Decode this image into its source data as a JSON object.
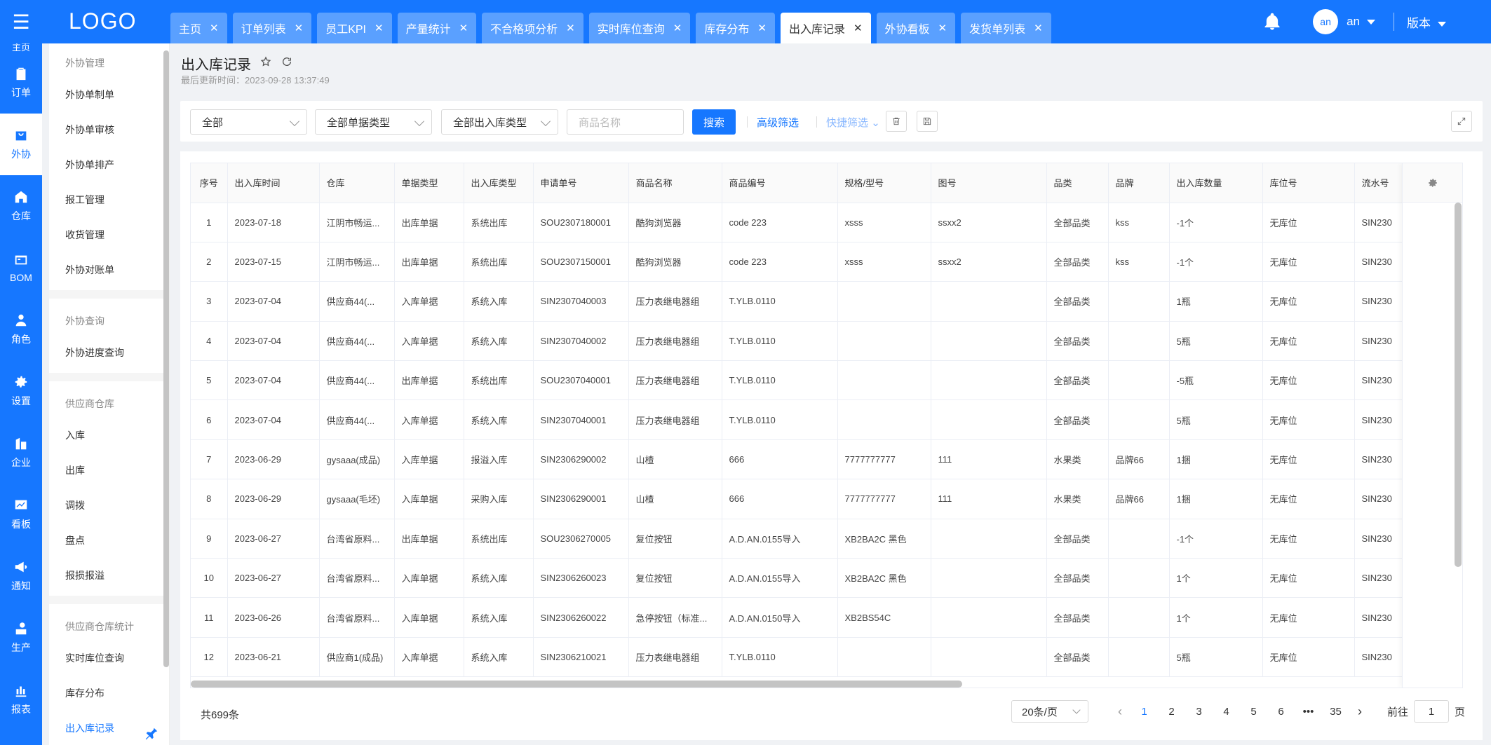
{
  "rail": [
    {
      "label": "主页",
      "icon": "home-icon"
    },
    {
      "label": "订单",
      "icon": "clipboard-icon"
    },
    {
      "label": "外协",
      "icon": "bag-icon"
    },
    {
      "label": "仓库",
      "icon": "warehouse-icon"
    },
    {
      "label": "BOM",
      "icon": "box-icon"
    },
    {
      "label": "角色",
      "icon": "user-icon"
    },
    {
      "label": "设置",
      "icon": "gear-icon"
    },
    {
      "label": "企业",
      "icon": "building-icon"
    },
    {
      "label": "看板",
      "icon": "chart-icon"
    },
    {
      "label": "通知",
      "icon": "megaphone-icon"
    },
    {
      "label": "生产",
      "icon": "factory-icon"
    },
    {
      "label": "报表",
      "icon": "report-icon"
    }
  ],
  "header": {
    "logo": "LOGO",
    "tabs": [
      "主页",
      "订单列表",
      "员工KPI",
      "产量统计",
      "不合格项分析",
      "实时库位查询",
      "库存分布",
      "出入库记录",
      "外协看板",
      "发货单列表"
    ],
    "active_tab": "出入库记录",
    "avatar": "an",
    "user": "an",
    "version": "版本"
  },
  "submenu": {
    "groups": [
      {
        "title": "外协管理",
        "items": [
          "外协单制单",
          "外协单审核",
          "外协单排产",
          "报工管理",
          "收货管理",
          "外协对账单"
        ]
      },
      {
        "title": "外协查询",
        "items": [
          "外协进度查询"
        ]
      },
      {
        "title": "供应商仓库",
        "items": [
          "入库",
          "出库",
          "调拨",
          "盘点",
          "报损报溢"
        ]
      },
      {
        "title": "供应商仓库统计",
        "items": [
          "实时库位查询",
          "库存分布",
          "出入库记录"
        ]
      }
    ],
    "active": "出入库记录"
  },
  "page": {
    "title": "出入库记录",
    "updated": "最后更新时间：2023-09-28 13:37:49"
  },
  "filters": {
    "select_all": "全部",
    "doc_type": "全部单据类型",
    "io_type": "全部出入库类型",
    "product_placeholder": "商品名称",
    "search": "搜索",
    "advanced": "高级筛选",
    "quick": "快捷筛选"
  },
  "table": {
    "columns": [
      "序号",
      "出入库时间",
      "仓库",
      "单据类型",
      "出入库类型",
      "申请单号",
      "商品名称",
      "商品编号",
      "规格/型号",
      "图号",
      "品类",
      "品牌",
      "出入库数量",
      "库位号",
      "流水号"
    ],
    "rows": [
      [
        "1",
        "2023-07-18",
        "江阴市畅运...",
        "出库单据",
        "系统出库",
        "SOU2307180001",
        "酷狗浏览器",
        "code 223",
        "xsss",
        "ssxx2",
        "全部品类",
        "kss",
        "-1个",
        "无库位",
        "SIN230"
      ],
      [
        "2",
        "2023-07-15",
        "江阴市畅运...",
        "出库单据",
        "系统出库",
        "SOU2307150001",
        "酷狗浏览器",
        "code 223",
        "xsss",
        "ssxx2",
        "全部品类",
        "kss",
        "-1个",
        "无库位",
        "SIN230"
      ],
      [
        "3",
        "2023-07-04",
        "供应商44(...",
        "入库单据",
        "系统入库",
        "SIN2307040003",
        "压力表继电器组",
        "T.YLB.0110",
        "",
        "",
        "全部品类",
        "",
        "1瓶",
        "无库位",
        "SIN230"
      ],
      [
        "4",
        "2023-07-04",
        "供应商44(...",
        "入库单据",
        "系统入库",
        "SIN2307040002",
        "压力表继电器组",
        "T.YLB.0110",
        "",
        "",
        "全部品类",
        "",
        "5瓶",
        "无库位",
        "SIN230"
      ],
      [
        "5",
        "2023-07-04",
        "供应商44(...",
        "出库单据",
        "系统出库",
        "SOU2307040001",
        "压力表继电器组",
        "T.YLB.0110",
        "",
        "",
        "全部品类",
        "",
        "-5瓶",
        "无库位",
        "SIN230"
      ],
      [
        "6",
        "2023-07-04",
        "供应商44(...",
        "入库单据",
        "系统入库",
        "SIN2307040001",
        "压力表继电器组",
        "T.YLB.0110",
        "",
        "",
        "全部品类",
        "",
        "5瓶",
        "无库位",
        "SIN230"
      ],
      [
        "7",
        "2023-06-29",
        "gysaaa(成品)",
        "入库单据",
        "报溢入库",
        "SIN2306290002",
        "山楂",
        "666",
        "7777777777",
        "111",
        "水果类",
        "品牌66",
        "1捆",
        "无库位",
        "SIN230"
      ],
      [
        "8",
        "2023-06-29",
        "gysaaa(毛坯)",
        "入库单据",
        "采购入库",
        "SIN2306290001",
        "山楂",
        "666",
        "7777777777",
        "111",
        "水果类",
        "品牌66",
        "1捆",
        "无库位",
        "SIN230"
      ],
      [
        "9",
        "2023-06-27",
        "台湾省原料...",
        "出库单据",
        "系统出库",
        "SOU2306270005",
        "复位按钮",
        "A.D.AN.0155导入",
        "XB2BA2C 黑色",
        "",
        "全部品类",
        "",
        "-1个",
        "无库位",
        "SIN230"
      ],
      [
        "10",
        "2023-06-27",
        "台湾省原料...",
        "入库单据",
        "系统入库",
        "SIN2306260023",
        "复位按钮",
        "A.D.AN.0155导入",
        "XB2BA2C 黑色",
        "",
        "全部品类",
        "",
        "1个",
        "无库位",
        "SIN230"
      ],
      [
        "11",
        "2023-06-26",
        "台湾省原料...",
        "入库单据",
        "系统入库",
        "SIN2306260022",
        "急停按钮（标准...",
        "A.D.AN.0150导入",
        "XB2BS54C",
        "",
        "全部品类",
        "",
        "1个",
        "无库位",
        "SIN230"
      ],
      [
        "12",
        "2023-06-21",
        "供应商1(成品)",
        "入库单据",
        "系统入库",
        "SIN2306210021",
        "压力表继电器组",
        "T.YLB.0110",
        "",
        "",
        "全部品类",
        "",
        "5瓶",
        "无库位",
        "SIN230"
      ]
    ]
  },
  "pagination": {
    "total": "共699条",
    "page_size": "20条/页",
    "pages": [
      "1",
      "2",
      "3",
      "4",
      "5",
      "6"
    ],
    "ellipsis": "•••",
    "last": "35",
    "current": "1",
    "goto_prefix": "前往",
    "goto_value": "1",
    "goto_suffix": "页"
  },
  "colors": {
    "primary": "#1677ff"
  }
}
